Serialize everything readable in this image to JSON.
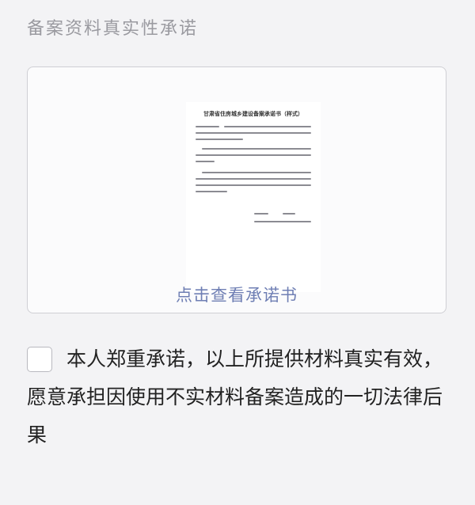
{
  "section": {
    "title": "备案资料真实性承诺"
  },
  "document": {
    "heading": "甘肃省住房城乡建设备案承诺书（样式）",
    "view_link": "点击查看承诺书"
  },
  "pledge": {
    "checked": false,
    "text": "本人郑重承诺，以上所提供材料真实有效，愿意承担因使用不实材料备案造成的一切法律后果"
  }
}
